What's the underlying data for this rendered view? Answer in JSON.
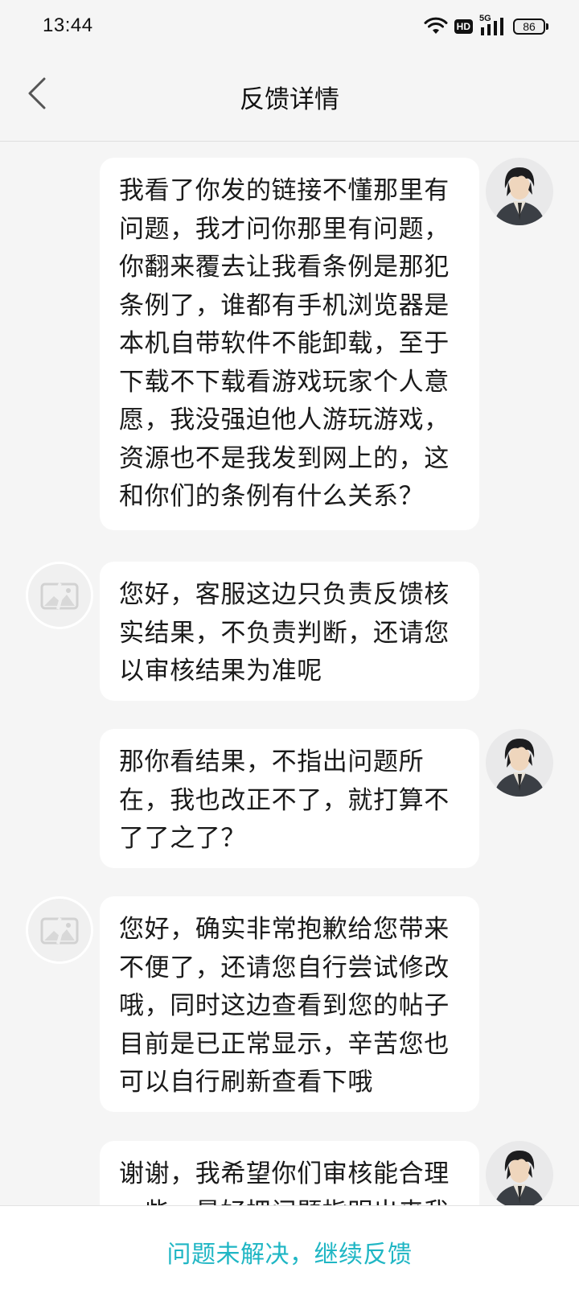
{
  "status_bar": {
    "time": "13:44",
    "hd_label": "HD",
    "network_label": "5G",
    "battery_level": "86"
  },
  "header": {
    "title": "反馈详情"
  },
  "messages": [
    {
      "sender": "user",
      "text": "我看了你发的链接不懂那里有问题，我才问你那里有问题，你翻来覆去让我看条例是那犯条例了，谁都有手机浏览器是本机自带软件不能卸载，至于下载不下载看游戏玩家个人意愿，我没强迫他人游玩游戏，资源也不是我发到网上的，这和你们的条例有什么关系？"
    },
    {
      "sender": "service",
      "text": "您好，客服这边只负责反馈核实结果，不负责判断，还请您以审核结果为准呢"
    },
    {
      "sender": "user",
      "text": "那你看结果，不指出问题所在，我也改正不了，就打算不了了之了？"
    },
    {
      "sender": "service",
      "text": "您好，确实非常抱歉给您带来不便了，还请您自行尝试修改哦，同时这边查看到您的帖子目前是已正常显示，辛苦您也可以自行刷新查看下哦"
    },
    {
      "sender": "user",
      "text": "谢谢，我希望你们审核能合理一些，最好把问题指明出来我"
    }
  ],
  "footer": {
    "button_label": "问题未解决，继续反馈"
  },
  "colors": {
    "accent": "#1fb6c4",
    "background": "#f5f5f5",
    "bubble": "#ffffff"
  }
}
